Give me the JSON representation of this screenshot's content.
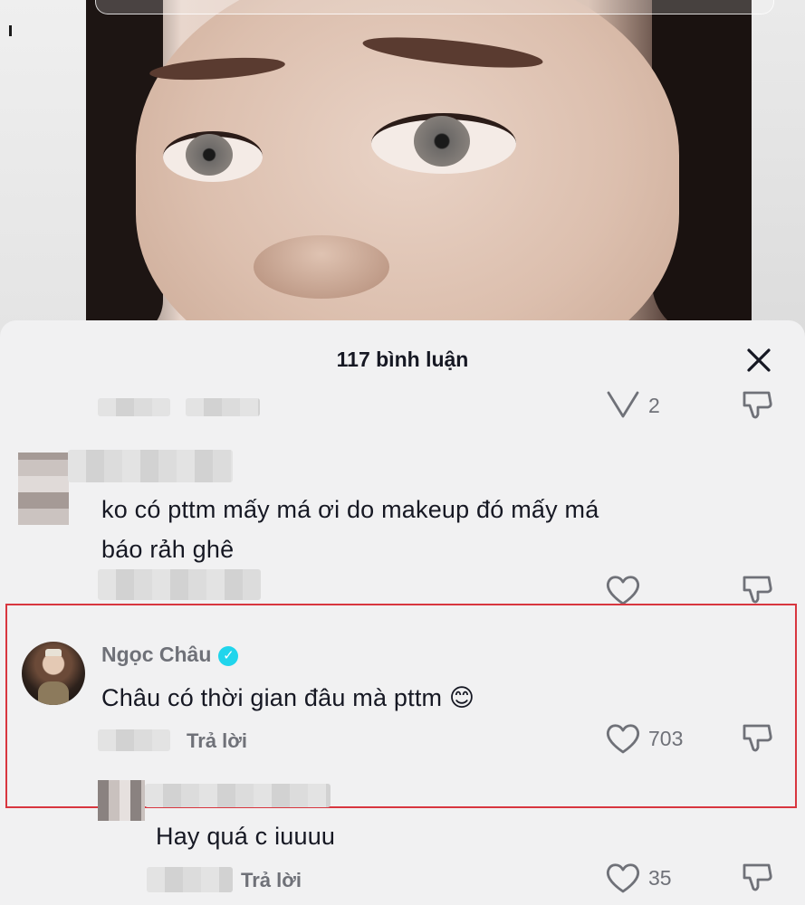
{
  "sheet": {
    "title": "117 bình luận"
  },
  "comments": [
    {
      "username": "",
      "text": "",
      "likes": "2"
    },
    {
      "username": "",
      "text_line1": "ko có pttm mấy má ơi do makeup đó mấy má",
      "text_line2": "báo rảh ghê",
      "likes": ""
    },
    {
      "username": "Ngọc Châu",
      "verified": true,
      "text": "Châu có thời gian đâu mà pttm 😊",
      "reply_label": "Trả lời",
      "likes": "703"
    },
    {
      "username": "",
      "text": "Hay quá c iuuuu",
      "reply_label": "Trả lời",
      "likes": "35"
    }
  ],
  "icons": {
    "close": "close-icon",
    "like": "heart-icon",
    "dislike": "dislike-icon",
    "verified": "verified-badge-icon"
  },
  "colors": {
    "highlight_border": "#d8363f",
    "verified": "#20d5ec",
    "secondary_text": "#6f7178",
    "primary_text": "#161823"
  }
}
